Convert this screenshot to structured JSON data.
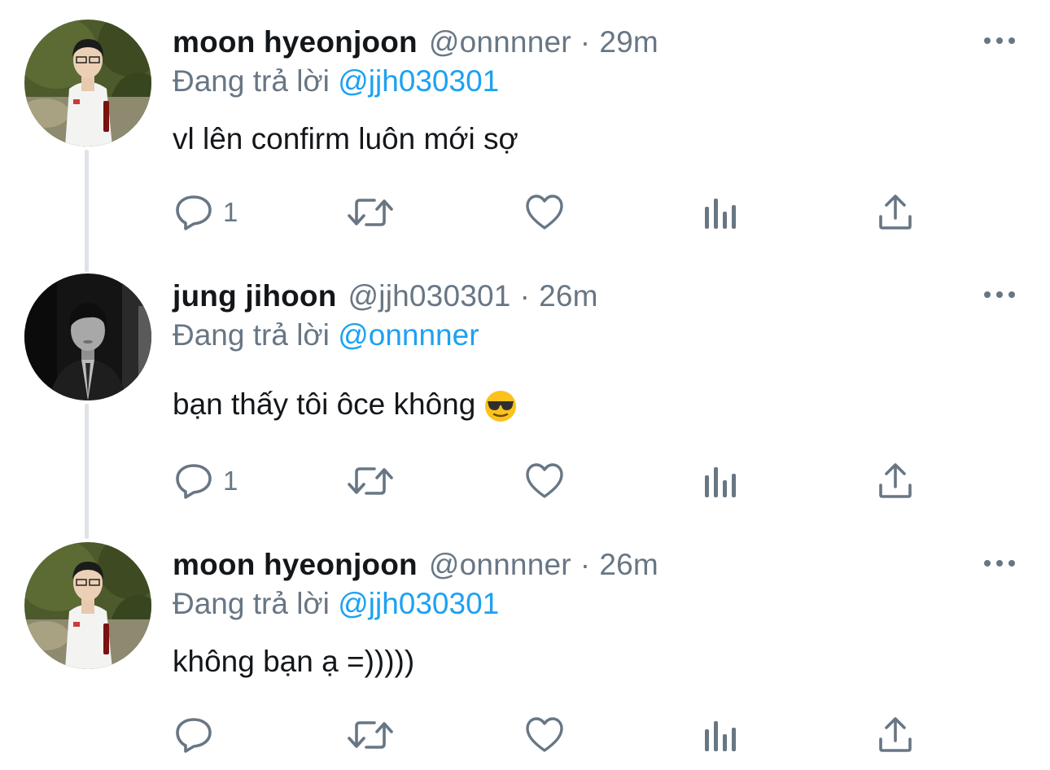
{
  "colors": {
    "text": "#14171a",
    "secondary": "#687684",
    "link": "#1da1f2",
    "thread_line": "#dfe3e7"
  },
  "tweets": [
    {
      "name": "moon hyeonjoon",
      "handle": "@onnnner",
      "separator": "·",
      "time": "29m",
      "replying_prefix": "Đang trả lời",
      "replying_to": "@jjh030301",
      "text": "vl lên confirm luôn mới sợ",
      "reply_count": "1",
      "avatar": "avatar-moon-hyeonjoon"
    },
    {
      "name": "jung jihoon",
      "handle": "@jjh030301",
      "separator": "·",
      "time": "26m",
      "replying_prefix": "Đang trả lời",
      "replying_to": "@onnnner",
      "text": "bạn thấy tôi ôce không",
      "emoji": "smiling-face-with-sunglasses",
      "reply_count": "1",
      "avatar": "avatar-jung-jihoon"
    },
    {
      "name": "moon hyeonjoon",
      "handle": "@onnnner",
      "separator": "·",
      "time": "26m",
      "replying_prefix": "Đang trả lời",
      "replying_to": "@jjh030301",
      "text": "không bạn ạ =)))))",
      "reply_count": "",
      "avatar": "avatar-moon-hyeonjoon"
    }
  ],
  "icons": {
    "reply": "reply-icon",
    "retweet": "retweet-icon",
    "like": "heart-icon",
    "analytics": "analytics-icon",
    "share": "share-icon",
    "more": "more-icon"
  }
}
